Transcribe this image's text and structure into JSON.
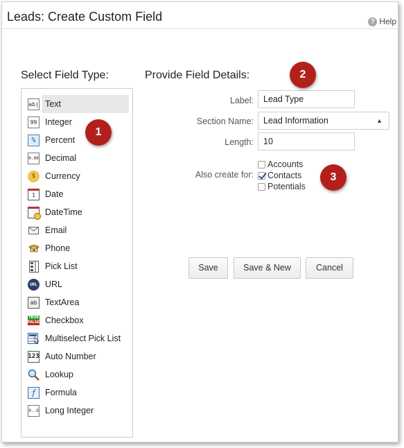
{
  "window": {
    "title": "Leads: Create Custom Field",
    "help_label": "Help"
  },
  "left_panel": {
    "heading": "Select Field Type:",
    "field_types": [
      {
        "label": "Text",
        "icon": "text-field-icon",
        "selected": true
      },
      {
        "label": "Integer",
        "icon": "integer-icon"
      },
      {
        "label": "Percent",
        "icon": "percent-icon"
      },
      {
        "label": "Decimal",
        "icon": "decimal-icon"
      },
      {
        "label": "Currency",
        "icon": "currency-icon"
      },
      {
        "label": "Date",
        "icon": "calendar-icon"
      },
      {
        "label": "DateTime",
        "icon": "calendar-clock-icon"
      },
      {
        "label": "Email",
        "icon": "envelope-icon"
      },
      {
        "label": "Phone",
        "icon": "phone-icon"
      },
      {
        "label": "Pick List",
        "icon": "picklist-icon"
      },
      {
        "label": "URL",
        "icon": "url-globe-icon"
      },
      {
        "label": "TextArea",
        "icon": "textarea-icon"
      },
      {
        "label": "Checkbox",
        "icon": "true-false-icon"
      },
      {
        "label": "Multiselect Pick List",
        "icon": "multiselect-icon"
      },
      {
        "label": "Auto Number",
        "icon": "auto-number-icon"
      },
      {
        "label": "Lookup",
        "icon": "magnifier-icon"
      },
      {
        "label": "Formula",
        "icon": "formula-icon"
      },
      {
        "label": "Long Integer",
        "icon": "long-integer-icon"
      }
    ]
  },
  "right_panel": {
    "heading": "Provide Field Details:",
    "label_field": {
      "label": "Label:",
      "value": "Lead Type"
    },
    "section_field": {
      "label": "Section Name:",
      "value": "Lead Information"
    },
    "length_field": {
      "label": "Length:",
      "value": "10"
    },
    "also_create": {
      "label": "Also create for:",
      "options": [
        {
          "label": "Accounts",
          "checked": false
        },
        {
          "label": "Contacts",
          "checked": true
        },
        {
          "label": "Potentials",
          "checked": false
        }
      ]
    },
    "buttons": {
      "save": "Save",
      "save_new": "Save & New",
      "cancel": "Cancel"
    }
  },
  "callouts": {
    "one": "1",
    "two": "2",
    "three": "3"
  },
  "colors": {
    "callout": "#b3201b",
    "selected_row": "#e7e7e7"
  }
}
